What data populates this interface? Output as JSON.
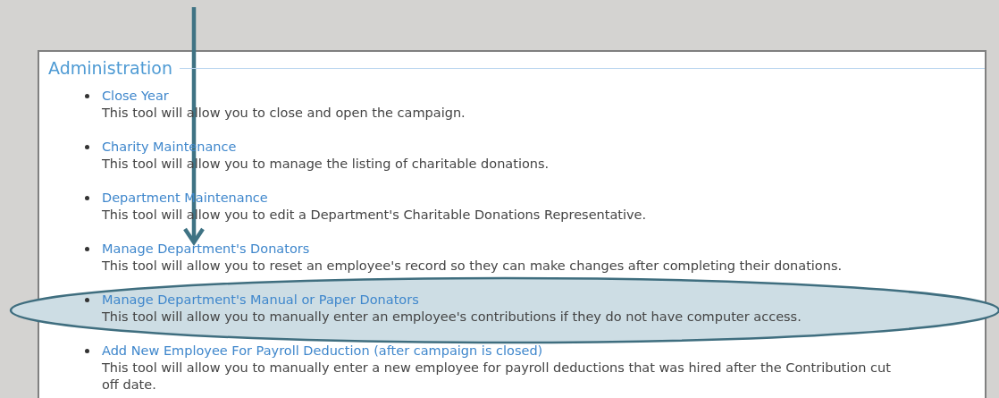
{
  "panel": {
    "title": "Administration"
  },
  "items": [
    {
      "link": "Close Year",
      "description": "This tool will allow you to close and open the campaign."
    },
    {
      "link": "Charity Maintenance",
      "description": "This tool will allow you to manage the listing of charitable donations."
    },
    {
      "link": "Department Maintenance",
      "description": "This tool will allow you to edit a Department's Charitable Donations Representative."
    },
    {
      "link": "Manage Department's Donators",
      "description": "This tool will allow you to reset an employee's record so they can make changes after completing their donations."
    },
    {
      "link": "Manage Department's Manual or Paper Donators",
      "description": "This tool will allow you to manually enter an employee's contributions if they do not have computer access."
    },
    {
      "link": "Add New Employee For Payroll Deduction (after campaign is closed)",
      "description": "This tool will allow you to manually enter a new employee for payroll deductions that was hired after the Contribution cut off date."
    }
  ],
  "annotations": {
    "arrow": true,
    "ellipse": true
  }
}
